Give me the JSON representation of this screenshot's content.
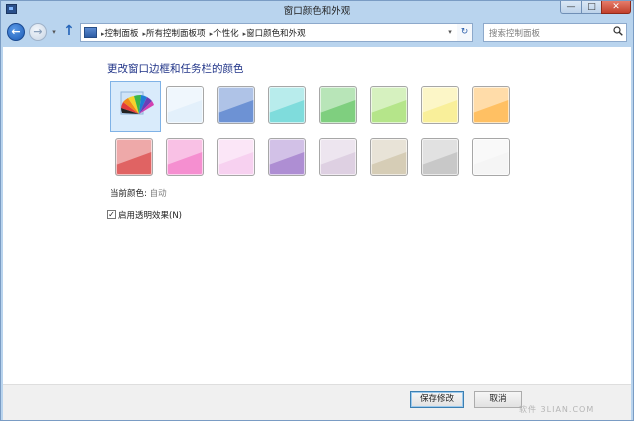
{
  "window": {
    "title": "窗口颜色和外观"
  },
  "titlebar_buttons": {
    "minimize": "—",
    "maximize": "□",
    "close": "✕"
  },
  "nav": {
    "back": "←",
    "forward": "→",
    "dropdown": "▾",
    "up": "↑"
  },
  "breadcrumb": [
    "控制面板",
    "所有控制面板项",
    "个性化",
    "窗口颜色和外观"
  ],
  "breadcrumb_separator": "▸",
  "address_dropdown": "▾",
  "refresh": "↻",
  "search": {
    "placeholder": "搜索控制面板"
  },
  "main": {
    "heading": "更改窗口边框和任务栏的颜色",
    "current_color_label": "当前颜色:",
    "current_color_value": "自动",
    "transparency": {
      "label": "启用透明效果(N)",
      "checked": true,
      "check_glyph": "✓"
    }
  },
  "swatches_row1": [
    {
      "name": "automatic",
      "color": ""
    },
    {
      "name": "sky",
      "color": "#e3f0fb"
    },
    {
      "name": "twilight",
      "color": "#6d92d4"
    },
    {
      "name": "sea-foam",
      "color": "#7fdcdc"
    },
    {
      "name": "leaf",
      "color": "#7fcf7f"
    },
    {
      "name": "lime",
      "color": "#b5e58a"
    },
    {
      "name": "lemon",
      "color": "#f9ef9a"
    },
    {
      "name": "pumpkin",
      "color": "#ffc063"
    }
  ],
  "swatches_row2": [
    {
      "name": "ruby",
      "color": "#e06363"
    },
    {
      "name": "fuchsia",
      "color": "#f58fd0"
    },
    {
      "name": "blush",
      "color": "#f7d1f0"
    },
    {
      "name": "violet",
      "color": "#ae8ed3"
    },
    {
      "name": "lavender",
      "color": "#ded0e2"
    },
    {
      "name": "taupe",
      "color": "#d6cdb6"
    },
    {
      "name": "chocolate",
      "color": "#c8c8c8"
    },
    {
      "name": "frost",
      "color": "#f5f5f5"
    }
  ],
  "footer": {
    "save": "保存修改",
    "cancel": "取消"
  },
  "watermark": "软件 3LIAN.COM"
}
